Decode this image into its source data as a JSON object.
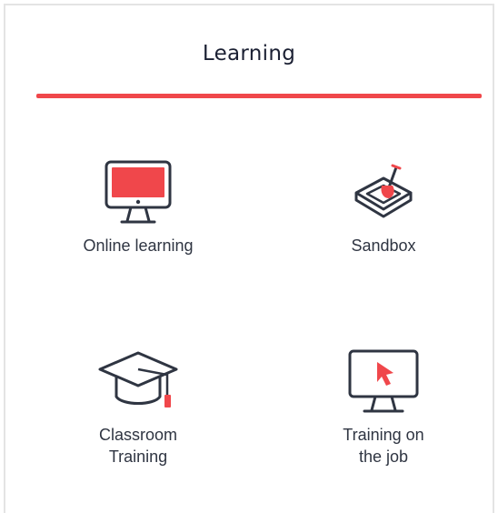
{
  "title": "Learning",
  "colors": {
    "accent": "#f0474b",
    "icon_stroke": "#2f3542",
    "title": "#1b2033"
  },
  "items": [
    {
      "label": "Online learning",
      "icon": "monitor-icon"
    },
    {
      "label": "Sandbox",
      "icon": "sandbox-shovel-icon"
    },
    {
      "label": "Classroom Training",
      "label_lines": [
        "Classroom",
        "Training"
      ],
      "icon": "graduation-cap-icon"
    },
    {
      "label": "Training on the job",
      "label_lines": [
        "Training on",
        "the job"
      ],
      "icon": "monitor-cursor-icon"
    }
  ]
}
